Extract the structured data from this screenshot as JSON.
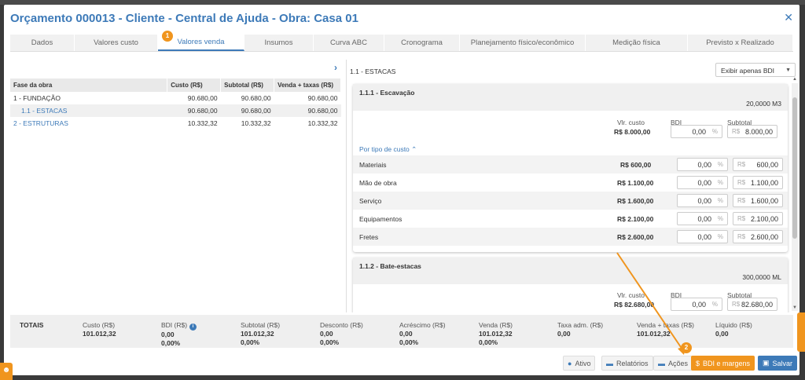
{
  "modal": {
    "title": "Orçamento 000013 - Cliente - Central de Ajuda - Obra: Casa 01"
  },
  "tabs": [
    {
      "label": "Dados"
    },
    {
      "label": "Valores custo"
    },
    {
      "label": "Valores venda"
    },
    {
      "label": "Insumos"
    },
    {
      "label": "Curva ABC"
    },
    {
      "label": "Cronograma"
    },
    {
      "label": "Planejamento físico/econômico"
    },
    {
      "label": "Medição física"
    },
    {
      "label": "Previsto x Realizado"
    }
  ],
  "badges": {
    "one": "1",
    "two": "2"
  },
  "phase_table": {
    "headers": [
      "Fase da obra",
      "Custo (R$)",
      "Subtotal (R$)",
      "Venda + taxas (R$)"
    ],
    "rows": [
      {
        "name": "1 - FUNDAÇÃO",
        "custo": "90.680,00",
        "subtotal": "90.680,00",
        "venda": "90.680,00"
      },
      {
        "name": "1.1 - ESTACAS",
        "custo": "90.680,00",
        "subtotal": "90.680,00",
        "venda": "90.680,00"
      },
      {
        "name": "2 - ESTRUTURAS",
        "custo": "10.332,32",
        "subtotal": "10.332,32",
        "venda": "10.332,32"
      }
    ]
  },
  "right": {
    "title": "1.1 - ESTACAS",
    "filter": "Exibir apenas BDI",
    "labels": {
      "vlr_custo": "Vlr. custo",
      "bdi": "BDI",
      "subtotal": "Subtotal",
      "pct": "%",
      "rs": "R$",
      "por_tipo": "Por tipo de custo"
    },
    "card1": {
      "name": "1.1.1 - Escavação",
      "qty": "20,0000 M3",
      "vlr_custo": "R$ 8.000,00",
      "bdi": "0,00",
      "subtotal": "8.000,00",
      "items": [
        {
          "label": "Materiais",
          "value": "R$ 600,00",
          "bdi": "0,00",
          "subtotal": "600,00"
        },
        {
          "label": "Mão de obra",
          "value": "R$ 1.100,00",
          "bdi": "0,00",
          "subtotal": "1.100,00"
        },
        {
          "label": "Serviço",
          "value": "R$ 1.600,00",
          "bdi": "0,00",
          "subtotal": "1.600,00"
        },
        {
          "label": "Equipamentos",
          "value": "R$ 2.100,00",
          "bdi": "0,00",
          "subtotal": "2.100,00"
        },
        {
          "label": "Fretes",
          "value": "R$ 2.600,00",
          "bdi": "0,00",
          "subtotal": "2.600,00"
        }
      ]
    },
    "card2": {
      "name": "1.1.2 - Bate-estacas",
      "qty": "300,0000 ML",
      "vlr_custo": "R$ 82.680,00",
      "bdi": "0,00",
      "subtotal": "82.680,00"
    }
  },
  "totals": {
    "label": "TOTAIS",
    "cols": [
      {
        "h": "Custo (R$)",
        "v1": "101.012,32",
        "v2": ""
      },
      {
        "h": "BDI (R$)",
        "v1": "0,00",
        "v2": "0,00%"
      },
      {
        "h": "Subtotal (R$)",
        "v1": "101.012,32",
        "v2": "0,00%"
      },
      {
        "h": "Desconto (R$)",
        "v1": "0,00",
        "v2": "0,00%"
      },
      {
        "h": "Acréscimo (R$)",
        "v1": "0,00",
        "v2": "0,00%"
      },
      {
        "h": "Venda (R$)",
        "v1": "101.012,32",
        "v2": "0,00%"
      },
      {
        "h": "Taxa adm. (R$)",
        "v1": "0,00",
        "v2": ""
      },
      {
        "h": "Venda + taxas (R$)",
        "v1": "101.012,32",
        "v2": ""
      },
      {
        "h": "Líquido (R$)",
        "v1": "0,00",
        "v2": ""
      }
    ]
  },
  "footer": {
    "ativo": "Ativo",
    "relatorios": "Relatórios",
    "acoes": "Ações",
    "bdi_margens": "BDI e margens",
    "salvar": "Salvar"
  },
  "colors": {
    "accent": "#3d7ab8",
    "orange": "#f0951e"
  }
}
